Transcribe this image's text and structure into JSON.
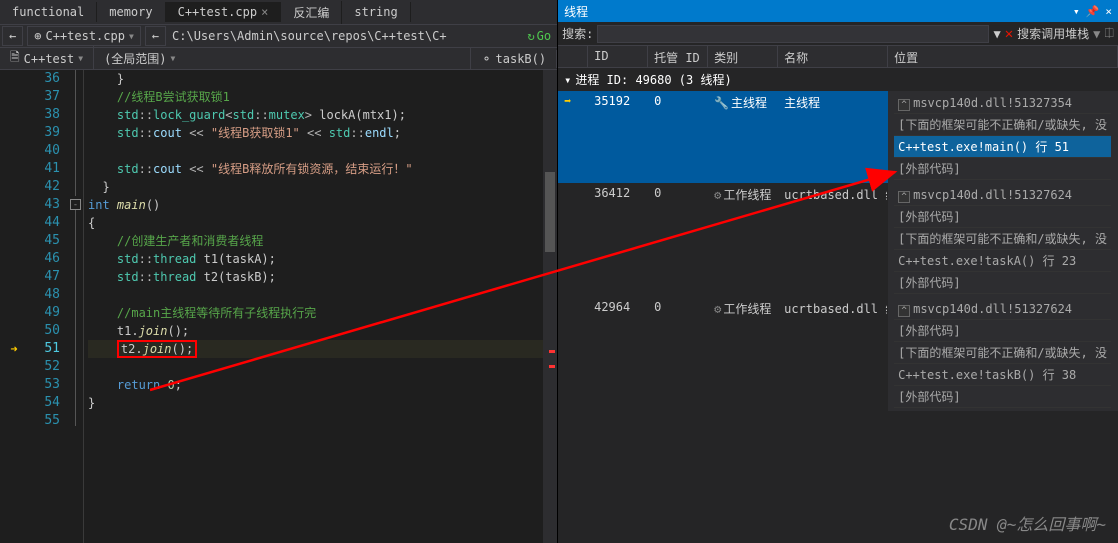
{
  "tabs": {
    "items": [
      "functional",
      "memory",
      "C++test.cpp",
      "反汇编",
      "string"
    ],
    "active": 2,
    "active_close": "×"
  },
  "toolbar": {
    "file_drop": "C++test.cpp",
    "path": "C:\\Users\\Admin\\source\\repos\\C++test\\C+",
    "go": "Go"
  },
  "breadcrumb": {
    "scope": "C++test",
    "fn_scope": "(全局范围)",
    "fn": "taskB()"
  },
  "lines": [
    {
      "n": 36,
      "html": "    }"
    },
    {
      "n": 37,
      "html": "    <span class='cmt'>//线程B尝试获取锁1</span>"
    },
    {
      "n": 38,
      "html": "    <span class='type'>std</span><span class='op'>::</span><span class='type'>lock_guard</span><span class='op'>&lt;</span><span class='type'>std</span><span class='op'>::</span><span class='type'>mutex</span><span class='op'>&gt;</span> lockA(mtx1);"
    },
    {
      "n": 39,
      "html": "    <span class='type'>std</span><span class='op'>::</span><span class='var'>cout</span> <span class='op'>&lt;&lt;</span> <span class='str'>\"线程B获取锁1\"</span> <span class='op'>&lt;&lt;</span> <span class='type'>std</span><span class='op'>::</span><span class='var'>endl</span>;"
    },
    {
      "n": 40,
      "html": ""
    },
    {
      "n": 41,
      "html": "    <span class='type'>std</span><span class='op'>::</span><span class='var'>cout</span> <span class='op'>&lt;&lt;</span> <span class='str'>\"线程B释放所有锁资源，结束运行！\"</span>"
    },
    {
      "n": 42,
      "html": "  }"
    },
    {
      "n": 43,
      "html": "<span class='kw'>int</span> <span class='fn-i'>main</span>()",
      "fold": "-"
    },
    {
      "n": 44,
      "html": "{"
    },
    {
      "n": 45,
      "html": "    <span class='cmt'>//创建生产者和消费者线程</span>"
    },
    {
      "n": 46,
      "html": "    <span class='type'>std</span><span class='op'>::</span><span class='type'>thread</span> t1(taskA);"
    },
    {
      "n": 47,
      "html": "    <span class='type'>std</span><span class='op'>::</span><span class='type'>thread</span> t2(taskB);"
    },
    {
      "n": 48,
      "html": ""
    },
    {
      "n": 49,
      "html": "    <span class='cmt'>//main主线程等待所有子线程执行完</span>"
    },
    {
      "n": 50,
      "html": "    t1.<span class='fn-i'>join</span>();"
    },
    {
      "n": 51,
      "html": "    <span class='box-hl'>t2.<span class='fn-i'>join</span>();</span>",
      "cur": true
    },
    {
      "n": 52,
      "html": ""
    },
    {
      "n": 53,
      "html": "    <span class='kw'>return</span> <span class='num'>0</span>;"
    },
    {
      "n": 54,
      "html": "}"
    },
    {
      "n": 55,
      "html": ""
    }
  ],
  "panel": {
    "title": "线程",
    "search_label": "搜索:",
    "search2_label": "搜索调用堆栈",
    "headers": {
      "id": "ID",
      "mid": "托管 ID",
      "cat": "类别",
      "name": "名称",
      "loc": "位置"
    },
    "proc": "进程 ID: 49680  (3 线程)",
    "threads": [
      {
        "sel": true,
        "cur": true,
        "id": "35192",
        "mid": "0",
        "cat": "主线程",
        "name": "主线程",
        "loc": [
          {
            "t": "msvcp140d.dll!51327354",
            "exp": true
          },
          {
            "t": "[下面的框架可能不正确和/或缺失, 没"
          },
          {
            "t": "C++test.exe!main() 行 51",
            "hl": true
          },
          {
            "t": "[外部代码]"
          }
        ]
      },
      {
        "id": "36412",
        "mid": "0",
        "cat": "工作线程",
        "name": "ucrtbased.dll 线程",
        "loc": [
          {
            "t": "msvcp140d.dll!51327624",
            "exp": true
          },
          {
            "t": "[外部代码]"
          },
          {
            "t": "[下面的框架可能不正确和/或缺失, 没"
          },
          {
            "t": "C++test.exe!taskA() 行 23"
          },
          {
            "t": "[外部代码]"
          }
        ]
      },
      {
        "id": "42964",
        "mid": "0",
        "cat": "工作线程",
        "name": "ucrtbased.dll 线程",
        "loc": [
          {
            "t": "msvcp140d.dll!51327624",
            "exp": true
          },
          {
            "t": "[外部代码]"
          },
          {
            "t": "[下面的框架可能不正确和/或缺失, 没"
          },
          {
            "t": "C++test.exe!taskB() 行 38"
          },
          {
            "t": "[外部代码]"
          }
        ]
      }
    ]
  },
  "watermark": "CSDN @~怎么回事啊~",
  "icons": {
    "cat_main": "🔧",
    "cat_work": "⚙",
    "cur_arrow": "➡"
  }
}
